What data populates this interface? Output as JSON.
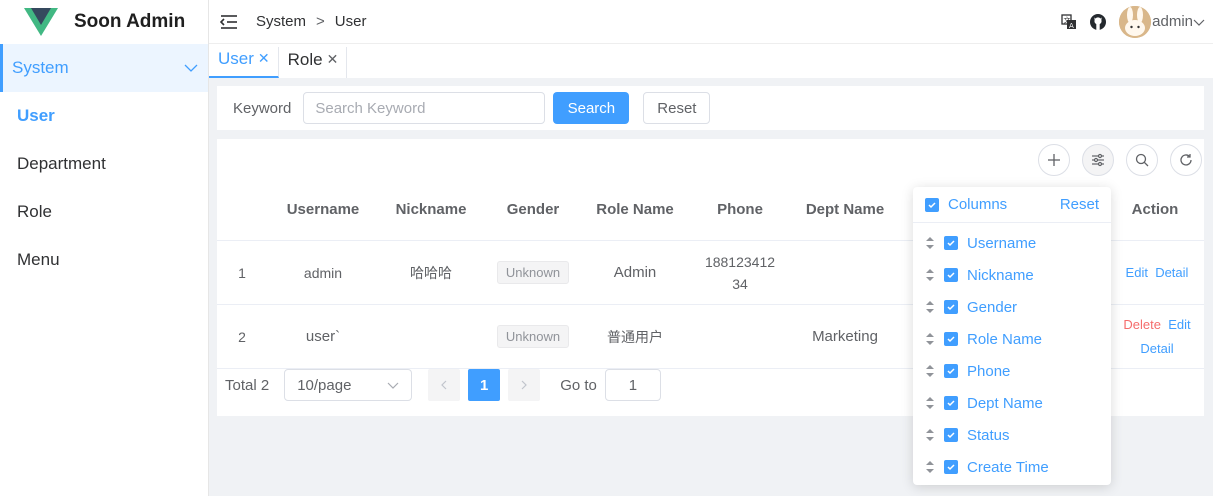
{
  "app": {
    "title": "Soon Admin"
  },
  "sidebar": {
    "group": "System",
    "items": [
      {
        "label": "User"
      },
      {
        "label": "Department"
      },
      {
        "label": "Role"
      },
      {
        "label": "Menu"
      }
    ]
  },
  "header": {
    "breadcrumb": [
      "System",
      "User"
    ],
    "user": "admin"
  },
  "tabs": [
    {
      "label": "User"
    },
    {
      "label": "Role"
    }
  ],
  "search": {
    "label": "Keyword",
    "placeholder": "Search Keyword",
    "search_btn": "Search",
    "reset_btn": "Reset"
  },
  "table": {
    "columns": [
      "Username",
      "Nickname",
      "Gender",
      "Role Name",
      "Phone",
      "Dept Name"
    ],
    "action_header": "Action",
    "rows": [
      {
        "index": "1",
        "username": "admin",
        "nickname": "哈哈哈",
        "gender": "Unknown",
        "role": "Admin",
        "phone": "188123412 34",
        "dept": "",
        "actions": [
          "Edit",
          "Detail"
        ]
      },
      {
        "index": "2",
        "username": "user`",
        "nickname": "",
        "gender": "Unknown",
        "role": "普通用户",
        "phone": "",
        "dept": "Marketing",
        "actions": [
          "Delete",
          "Edit",
          "Detail"
        ]
      }
    ]
  },
  "pager": {
    "total": "Total 2",
    "page_size": "10/page",
    "current": "1",
    "goto_label": "Go to",
    "goto_value": "1"
  },
  "columns_popover": {
    "title": "Columns",
    "reset": "Reset",
    "items": [
      "Username",
      "Nickname",
      "Gender",
      "Role Name",
      "Phone",
      "Dept Name",
      "Status",
      "Create Time"
    ]
  },
  "colors": {
    "accent": "#409eff",
    "danger": "#f56c6c"
  }
}
